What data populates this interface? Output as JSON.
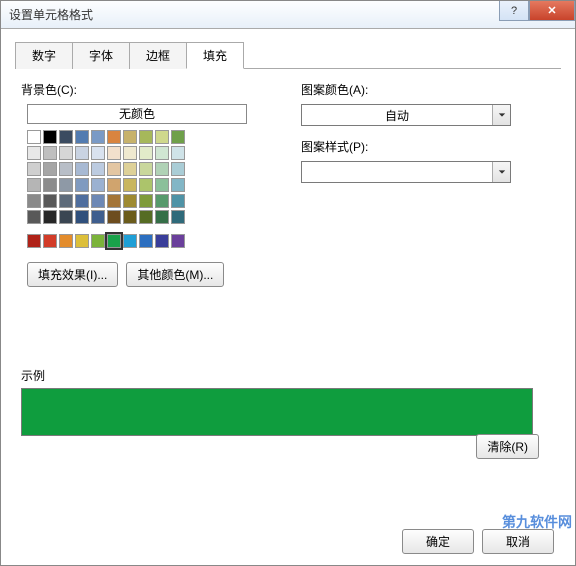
{
  "title": "设置单元格格式",
  "tabs": [
    "数字",
    "字体",
    "边框",
    "填充"
  ],
  "activeTab": 3,
  "left": {
    "bgLabel": "背景色(C):",
    "noColor": "无颜色",
    "fillEffects": "填充效果(I)...",
    "moreColors": "其他颜色(M)..."
  },
  "right": {
    "patternColorLabel": "图案颜色(A):",
    "patternColorValue": "自动",
    "patternStyleLabel": "图案样式(P):",
    "patternStyleValue": ""
  },
  "sampleLabel": "示例",
  "sampleColor": "#0f9d3e",
  "clearBtn": "清除(R)",
  "okBtn": "确定",
  "cancelBtn": "取消",
  "watermark": "第九软件网",
  "palette": {
    "row1": [
      "#ffffff",
      "#000000",
      "#3b4b60",
      "#527bb0",
      "#7a9ac6",
      "#d9843f",
      "#c7b26b",
      "#a6b85a",
      "#cfd88c",
      "#6fa04a"
    ],
    "row2": [
      "#e8e8e8",
      "#bfbfbf",
      "#d6d6d6",
      "#c9d3e2",
      "#d9e2ef",
      "#f2e0cc",
      "#efe9d0",
      "#e2ebc9",
      "#d0e6d2",
      "#cfe3e8"
    ],
    "row3": [
      "#cfcfcf",
      "#a6a6a6",
      "#b8bec7",
      "#a7b9d3",
      "#bccbe0",
      "#e3c6a2",
      "#ded198",
      "#c9d79c",
      "#b0d2b6",
      "#aacdd6"
    ],
    "row4": [
      "#b5b5b5",
      "#8c8c8c",
      "#8e99a6",
      "#7f9ac0",
      "#9bb1d1",
      "#d0a46e",
      "#c9b65f",
      "#acc46b",
      "#8bc09a",
      "#82b6c6"
    ],
    "row5": [
      "#8a8a8a",
      "#595959",
      "#5e6b7a",
      "#4f6e9e",
      "#6d88b5",
      "#a47538",
      "#9e8a32",
      "#7f9b3a",
      "#579a6c",
      "#4f93a6"
    ],
    "row6": [
      "#595959",
      "#262626",
      "#3a4652",
      "#30507c",
      "#3f5e8e",
      "#6d4d1f",
      "#6b5c1c",
      "#566c24",
      "#356f48",
      "#2f6a7a"
    ],
    "nogap": true,
    "row7": [
      "#b02218",
      "#d23c28",
      "#e38c2c",
      "#dcbf3a",
      "#7bb33a",
      "#19a24a",
      "#1f9fd6",
      "#2c6fc0",
      "#3a3e9a",
      "#6a3f9b"
    ]
  },
  "selectedSwatch": "r7c5"
}
